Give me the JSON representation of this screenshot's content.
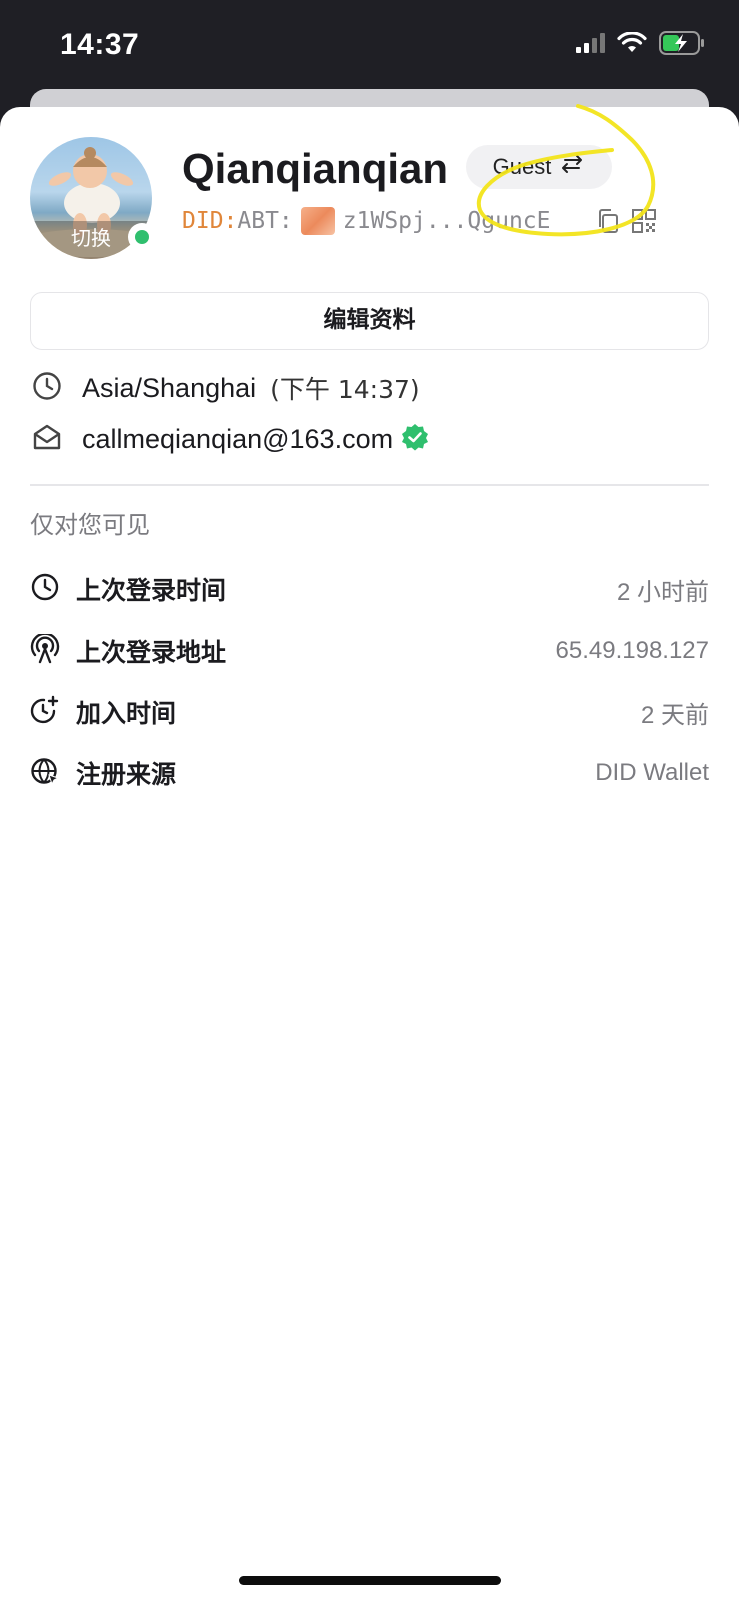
{
  "status_bar": {
    "time": "14:37",
    "icons": [
      "signal-icon",
      "wifi-icon",
      "battery-charging-icon"
    ]
  },
  "profile": {
    "name": "Qianqianqian",
    "avatar_overlay_label": "切换",
    "online_status_color": "#2fbf6e",
    "role_label": "Guest",
    "did": {
      "prefix": "DID:",
      "chain": "ABT:",
      "address": "z1WSpj...QguncE"
    }
  },
  "edit_button_label": "编辑资料",
  "contact": {
    "timezone": "Asia/Shanghai",
    "local_time": "(下午 14:37)",
    "email": "callmeqianqian@163.com",
    "email_verified_color": "#2fbf6e"
  },
  "private_section": {
    "label": "仅对您可见",
    "rows": [
      {
        "icon": "clock-icon",
        "label": "上次登录时间",
        "value": "2 小时前"
      },
      {
        "icon": "broadcast-icon",
        "label": "上次登录地址",
        "value": "65.49.198.127"
      },
      {
        "icon": "clock-plus-icon",
        "label": "加入时间",
        "value": "2 天前"
      },
      {
        "icon": "globe-icon",
        "label": "注册来源",
        "value": "DID Wallet"
      }
    ]
  },
  "colors": {
    "did_prefix": "#e0863a",
    "annotation": "#f2e41a"
  }
}
